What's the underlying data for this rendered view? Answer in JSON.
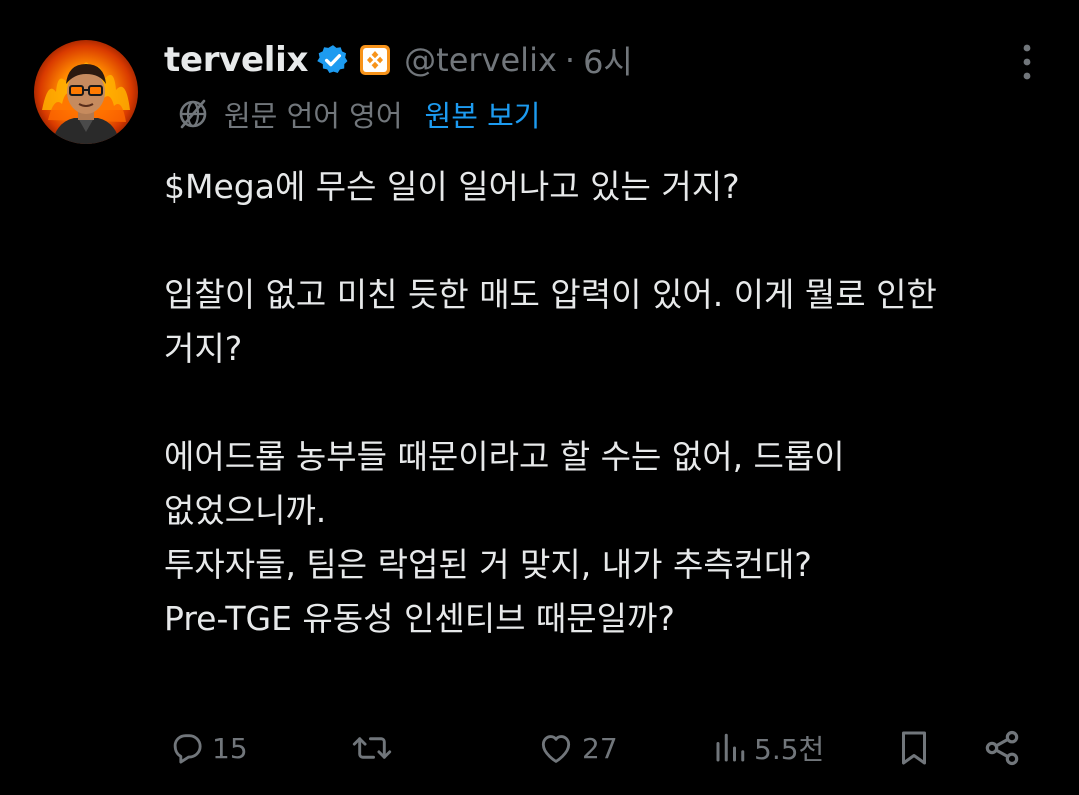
{
  "colors": {
    "background": "#000000",
    "text": "#e7e9ea",
    "muted": "#71767b",
    "link": "#1d9bf0",
    "verified": "#1d9bf0",
    "affiliate_badge": "#f7931a"
  },
  "author": {
    "display_name": "tervelix",
    "handle": "@tervelix",
    "separator": "·",
    "time": "6시",
    "verified_icon": "verified-check-icon",
    "affiliate_icon": "affiliate-badge-icon"
  },
  "translation": {
    "icon": "translate-globe-icon",
    "note": "원문 언어 영어",
    "show_original": "원본 보기"
  },
  "body": {
    "lines": [
      "$Mega에 무슨 일이 일어나고 있는 거지?",
      "",
      "입찰이 없고 미친 듯한 매도 압력이 있어. 이게 뭘로 인한",
      "거지?",
      "",
      "에어드롭 농부들 때문이라고 할 수는 없어, 드롭이",
      "없었으니까.",
      "투자자들, 팀은 락업된 거 맞지, 내가 추측컨대?",
      "Pre-TGE 유동성 인센티브 때문일까?"
    ]
  },
  "actions": {
    "reply": {
      "icon": "reply-icon",
      "count": "15"
    },
    "repost": {
      "icon": "repost-icon",
      "count": ""
    },
    "like": {
      "icon": "heart-icon",
      "count": "27"
    },
    "views": {
      "icon": "views-icon",
      "count": "5.5천"
    },
    "bookmark": {
      "icon": "bookmark-icon"
    },
    "share": {
      "icon": "share-icon"
    }
  },
  "more_menu": {
    "icon": "more-vertical-icon"
  }
}
